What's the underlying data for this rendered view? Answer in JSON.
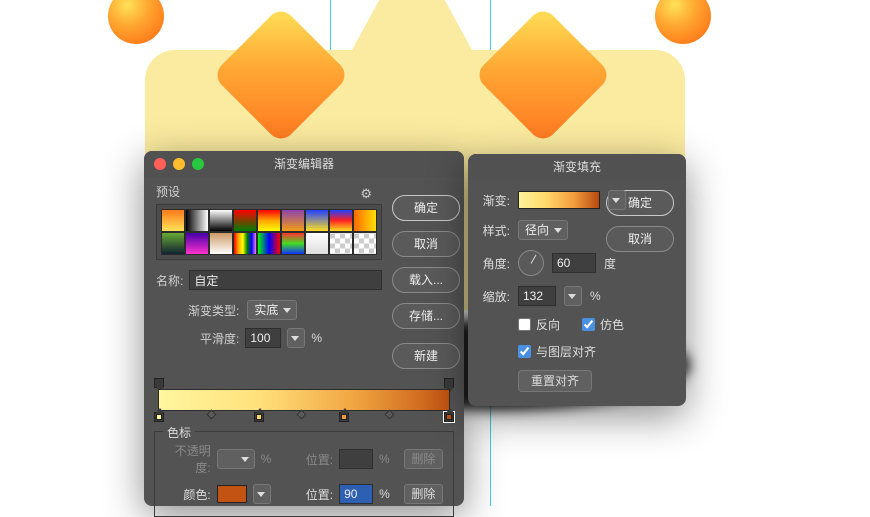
{
  "gradient_editor": {
    "title": "渐变编辑器",
    "presets_label": "预设",
    "buttons": {
      "ok": "确定",
      "cancel": "取消",
      "load": "载入...",
      "save": "存储...",
      "new": "新建"
    },
    "name_label": "名称:",
    "name_value": "自定",
    "type_label": "渐变类型:",
    "type_value": "实底",
    "smooth_label": "平滑度:",
    "smooth_value": "100",
    "smooth_unit": "%",
    "stops_legend": "色标",
    "opacity_label": "不透明度:",
    "opacity_unit": "%",
    "location_label": "位置:",
    "location_unit": "%",
    "delete_label": "删除",
    "color_label": "颜色:",
    "color_location_value": "90",
    "selected_stop_color": "#c25312",
    "gear_icon": "⚙"
  },
  "gradient_fill": {
    "title": "渐变填充",
    "gradient_label": "渐变:",
    "style_label": "样式:",
    "style_value": "径向",
    "angle_label": "角度:",
    "angle_value": "60",
    "angle_unit": "度",
    "scale_label": "缩放:",
    "scale_value": "132",
    "scale_unit": "%",
    "reverse_label": "反向",
    "dither_label": "仿色",
    "align_label": "与图层对齐",
    "reset_label": "重置对齐",
    "ok": "确定",
    "cancel": "取消",
    "reverse_checked": false,
    "dither_checked": true,
    "align_checked": true
  }
}
